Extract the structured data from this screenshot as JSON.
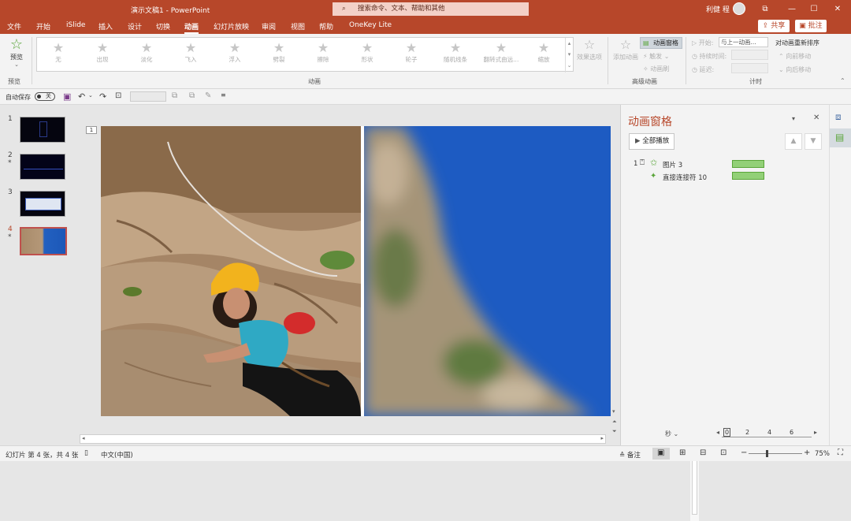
{
  "titlebar": {
    "title": "演示文稿1 - PowerPoint",
    "search_placeholder": "搜索命令、文本、帮助和其他",
    "user": "利健 程",
    "restore": "⧉",
    "minimize": "—",
    "maximize": "☐",
    "close": "✕"
  },
  "tabs": [
    "文件",
    "开始",
    "iSlide",
    "插入",
    "设计",
    "切换",
    "动画",
    "幻灯片放映",
    "审阅",
    "视图",
    "帮助",
    "OneKey Lite"
  ],
  "share": "共享",
  "comment": "批注",
  "ribbon": {
    "preview": "预览",
    "preview_group": "预览",
    "effects": [
      "无",
      "出现",
      "淡化",
      "飞入",
      "浮入",
      "劈裂",
      "擦除",
      "形状",
      "轮子",
      "随机线条",
      "翻转式由远...",
      "缩放"
    ],
    "effect_options": "效果选项",
    "animation_group": "动画",
    "add_animation": "添加动画",
    "animation_pane": "动画窗格",
    "trigger": "触发",
    "animation_painter": "动画刷",
    "advanced_group": "高级动画",
    "start_label": "开始:",
    "start_value": "与上一动画...",
    "duration_label": "持续时间:",
    "delay_label": "延迟:",
    "timing_group": "计时",
    "reorder": "对动画重新排序",
    "move_earlier": "向前移动",
    "move_later": "向后移动"
  },
  "qat": {
    "autosave": "自动保存",
    "autosave_state": "关"
  },
  "thumbs": [
    {
      "num": "1",
      "star": ""
    },
    {
      "num": "2",
      "star": "*"
    },
    {
      "num": "3",
      "star": ""
    },
    {
      "num": "4",
      "star": "*"
    }
  ],
  "slide_tags": {
    "left": "1",
    "right": "1"
  },
  "pane": {
    "title": "动画窗格",
    "play_all": "全部播放",
    "item1_num": "1",
    "item1_label": "图片 3",
    "item2_label": "直接连接符 10",
    "timeline": [
      "0",
      "2",
      "4",
      "6"
    ],
    "seconds": "秒"
  },
  "status": {
    "slide_info": "幻灯片 第 4 张，共 4 张",
    "language": "中文(中国)",
    "notes": "备注",
    "zoom": "75%"
  },
  "colors": {
    "accent": "#b7472a",
    "bar": "#92d077",
    "sky": "#1a5fc8"
  }
}
